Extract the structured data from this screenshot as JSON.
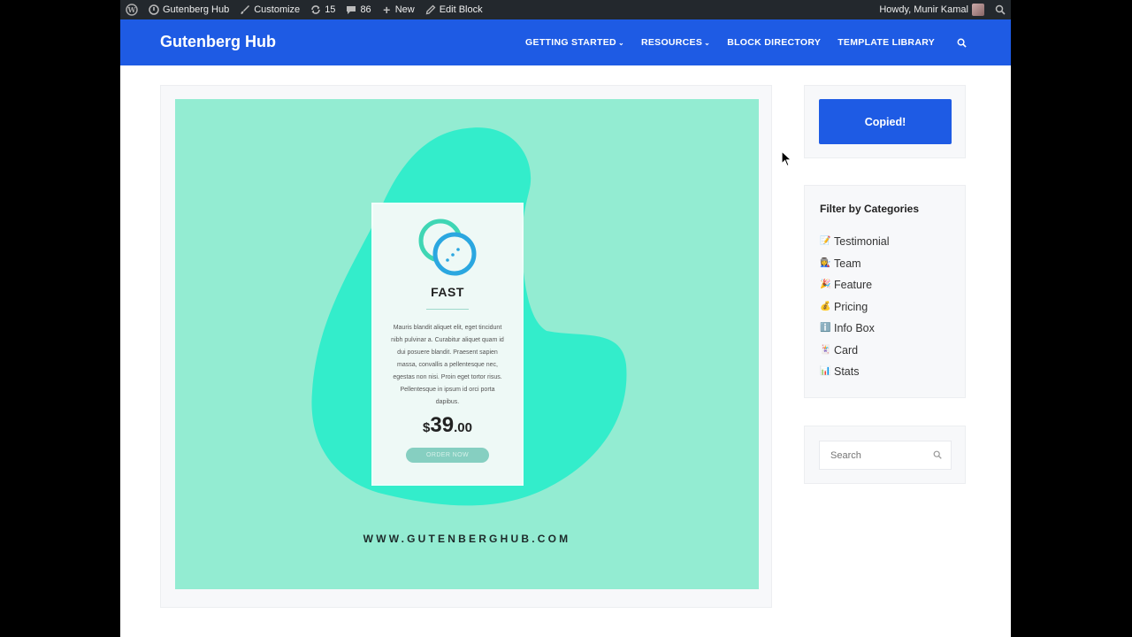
{
  "admin_bar": {
    "site_name": "Gutenberg Hub",
    "customize": "Customize",
    "updates_count": "15",
    "comments_count": "86",
    "new_label": "New",
    "edit_label": "Edit Block",
    "greeting": "Howdy, Munir Kamal"
  },
  "header": {
    "brand": "Gutenberg Hub",
    "nav": [
      {
        "label": "GETTING STARTED",
        "has_caret": true
      },
      {
        "label": "RESOURCES",
        "has_caret": true
      },
      {
        "label": "BLOCK DIRECTORY",
        "has_caret": false
      },
      {
        "label": "TEMPLATE LIBRARY",
        "has_caret": false
      }
    ]
  },
  "preview": {
    "card_title": "FAST",
    "description": "Mauris blandit aliquet elit, eget tincidunt nibh pulvinar a. Curabitur aliquet quam id dui posuere blandit. Praesent sapien massa, convallis a pellentesque nec, egestas non nisi. Proin eget tortor risus. Pellentesque in ipsum id orci porta dapibus.",
    "currency": "$",
    "price_whole": "39",
    "price_cents": ".00",
    "order_button": "ORDER NOW",
    "site_url": "WWW.GUTENBERGHUB.COM",
    "colors": {
      "background": "#93ecd2",
      "blob": "#33edcb",
      "card": "#eef9f6"
    }
  },
  "sidebar": {
    "copied_button": "Copied!",
    "categories_title": "Filter by Categories",
    "categories": [
      {
        "icon": "memo-icon",
        "glyph": "📝",
        "label": "Testimonial"
      },
      {
        "icon": "team-icon",
        "glyph": "👩‍🏭",
        "label": "Team"
      },
      {
        "icon": "party-icon",
        "glyph": "🎉",
        "label": "Feature"
      },
      {
        "icon": "money-bag-icon",
        "glyph": "💰",
        "label": "Pricing"
      },
      {
        "icon": "info-icon",
        "glyph": "ℹ️",
        "label": "Info Box"
      },
      {
        "icon": "card-icon",
        "glyph": "🃏",
        "label": "Card"
      },
      {
        "icon": "chart-icon",
        "glyph": "📊",
        "label": "Stats"
      }
    ],
    "search_placeholder": "Search"
  },
  "colors": {
    "brand_blue": "#1e5be4",
    "admin_bar": "#23282d"
  }
}
